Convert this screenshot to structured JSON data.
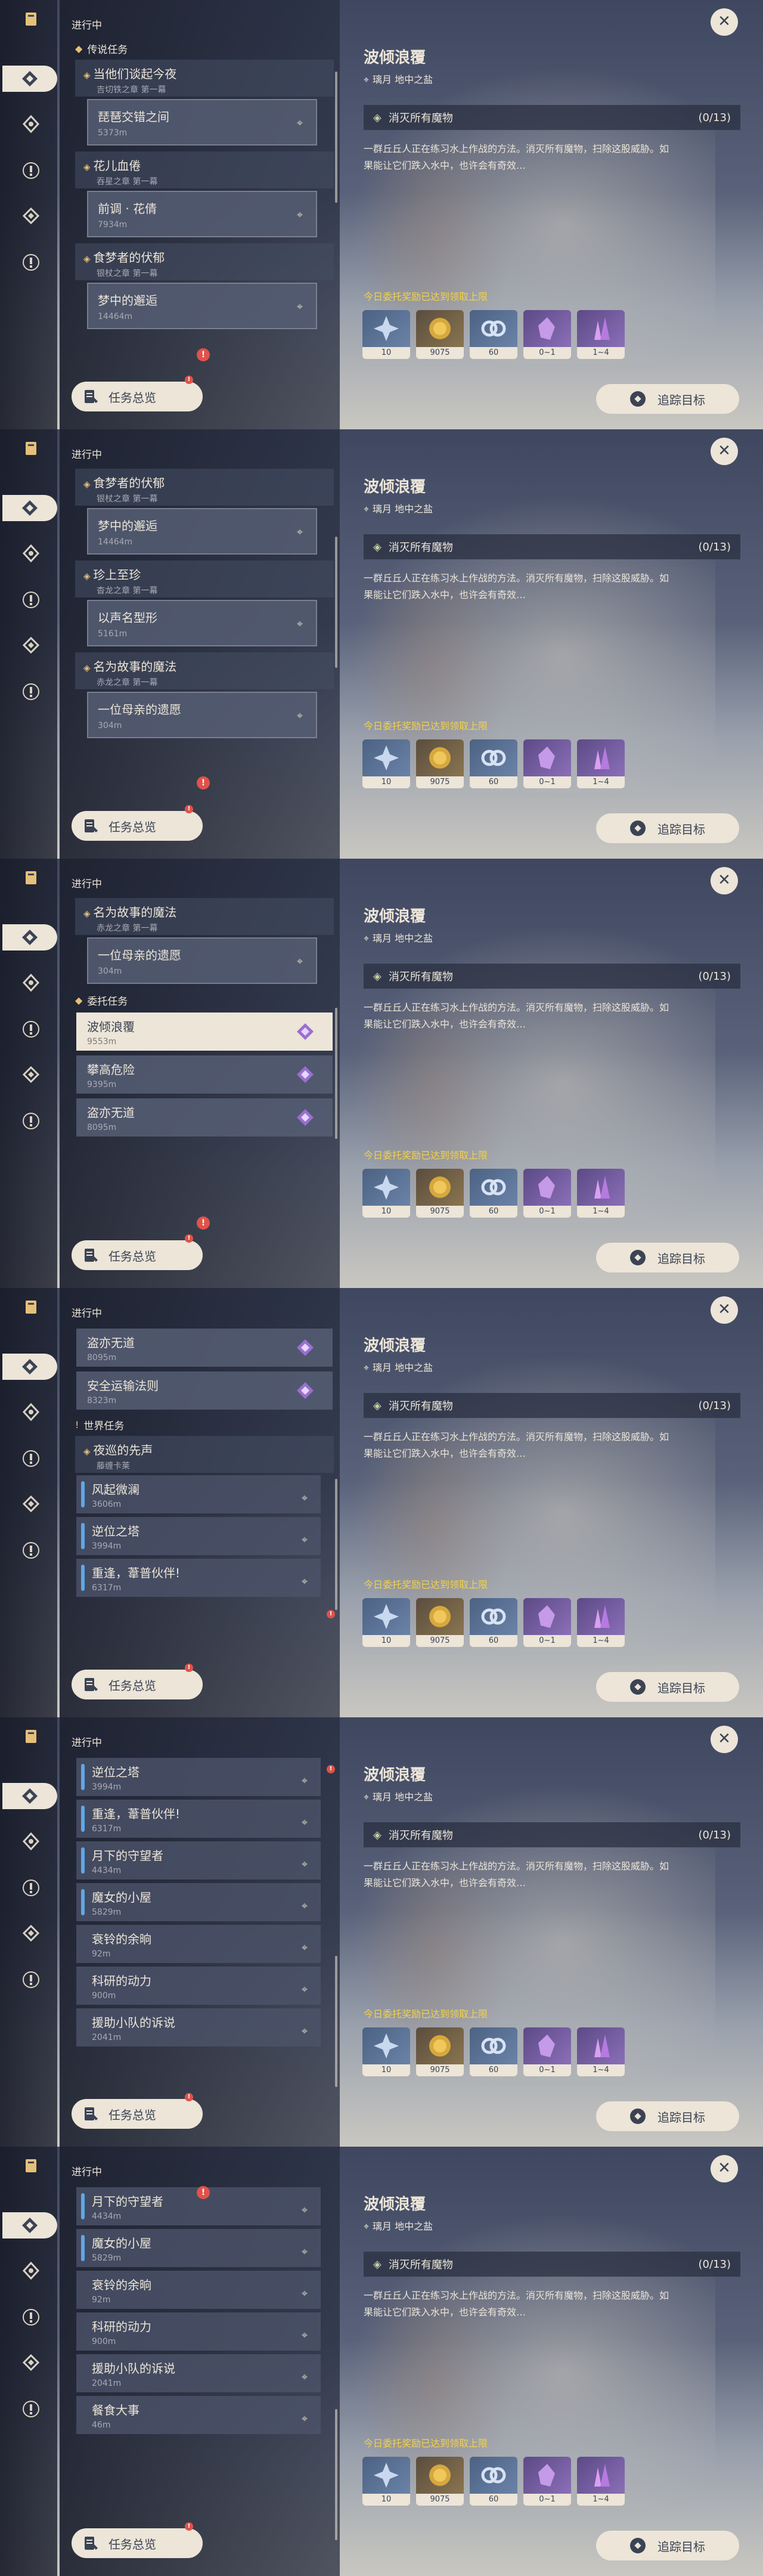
{
  "header": {
    "in_progress": "进行中"
  },
  "categories": {
    "legend": "传说任务",
    "commission": "委托任务",
    "world": "世界任务"
  },
  "legend_quests": [
    {
      "title": "当他们谈起今夜",
      "sub": "吉切铁之章 第一幕",
      "step": "琵琶交错之间",
      "dist": "5373m"
    },
    {
      "title": "花儿血倦",
      "sub": "吞星之章 第一幕",
      "step": "前调 · 花倩",
      "dist": "7934m"
    },
    {
      "title": "食梦者的伏郁",
      "sub": "银杖之章 第一幕",
      "step": "梦中的邂逅",
      "dist": "14464m"
    },
    {
      "title": "珍上至珍",
      "sub": "杳龙之章 第一幕",
      "step": "以声名型形",
      "dist": "5161m"
    },
    {
      "title": "名为故事的魔法",
      "sub": "赤龙之章 第一幕",
      "step": "一位母亲的遗愿",
      "dist": "304m"
    }
  ],
  "commissions": [
    {
      "title": "波倾浪覆",
      "dist": "9553m"
    },
    {
      "title": "攀高危险",
      "dist": "9395m"
    },
    {
      "title": "盗亦无道",
      "dist": "8095m"
    },
    {
      "title": "安全运输法则",
      "dist": "8323m"
    }
  ],
  "world_quests": [
    {
      "title": "夜巡的先声",
      "sub": "藤缠卡莱"
    },
    {
      "title": "风起微澜",
      "dist": "3606m"
    },
    {
      "title": "逆位之塔",
      "dist": "3994m"
    },
    {
      "title": "重逢，葦普伙伴!",
      "dist": "6317m"
    },
    {
      "title": "月下的守望者",
      "dist": "4434m"
    },
    {
      "title": "魔女的小屋",
      "dist": "5829m"
    },
    {
      "title": "衰铃的余晌",
      "dist": "92m"
    },
    {
      "title": "科研的动力",
      "dist": "900m"
    },
    {
      "title": "援助小队的诉说",
      "dist": "2041m"
    },
    {
      "title": "餐食大事",
      "dist": "46m"
    }
  ],
  "detail": {
    "title": "波倾浪覆",
    "location": "璃月 地中之盐",
    "objective": "消灭所有魔物",
    "objective_count": "(0/13)",
    "description_line1": "一群丘丘人正在练习水上作战的方法。消灭所有魔物，扫除这股威胁。如",
    "description_line2": "果能让它们跌入水中，也许会有奇效…",
    "reward_notice": "今日委托奖励已达到领取上限",
    "rewards": [
      {
        "icon": "adventure-exp-icon",
        "count": "10"
      },
      {
        "icon": "mora-icon",
        "count": "9075"
      },
      {
        "icon": "companionship-exp-icon",
        "count": "60"
      },
      {
        "icon": "mystic-ore-icon",
        "count": "0~1"
      },
      {
        "icon": "crystal-chunk-icon",
        "count": "1~4"
      }
    ]
  },
  "buttons": {
    "overview": "任务总览",
    "track": "追踪目标",
    "close": "✕"
  },
  "colors": {
    "accent": "#ece5d8",
    "gold": "#e5c07a",
    "reward_notice": "#f2d24b",
    "alert": "#e0524a",
    "world_bar": "#5fa7e8"
  }
}
